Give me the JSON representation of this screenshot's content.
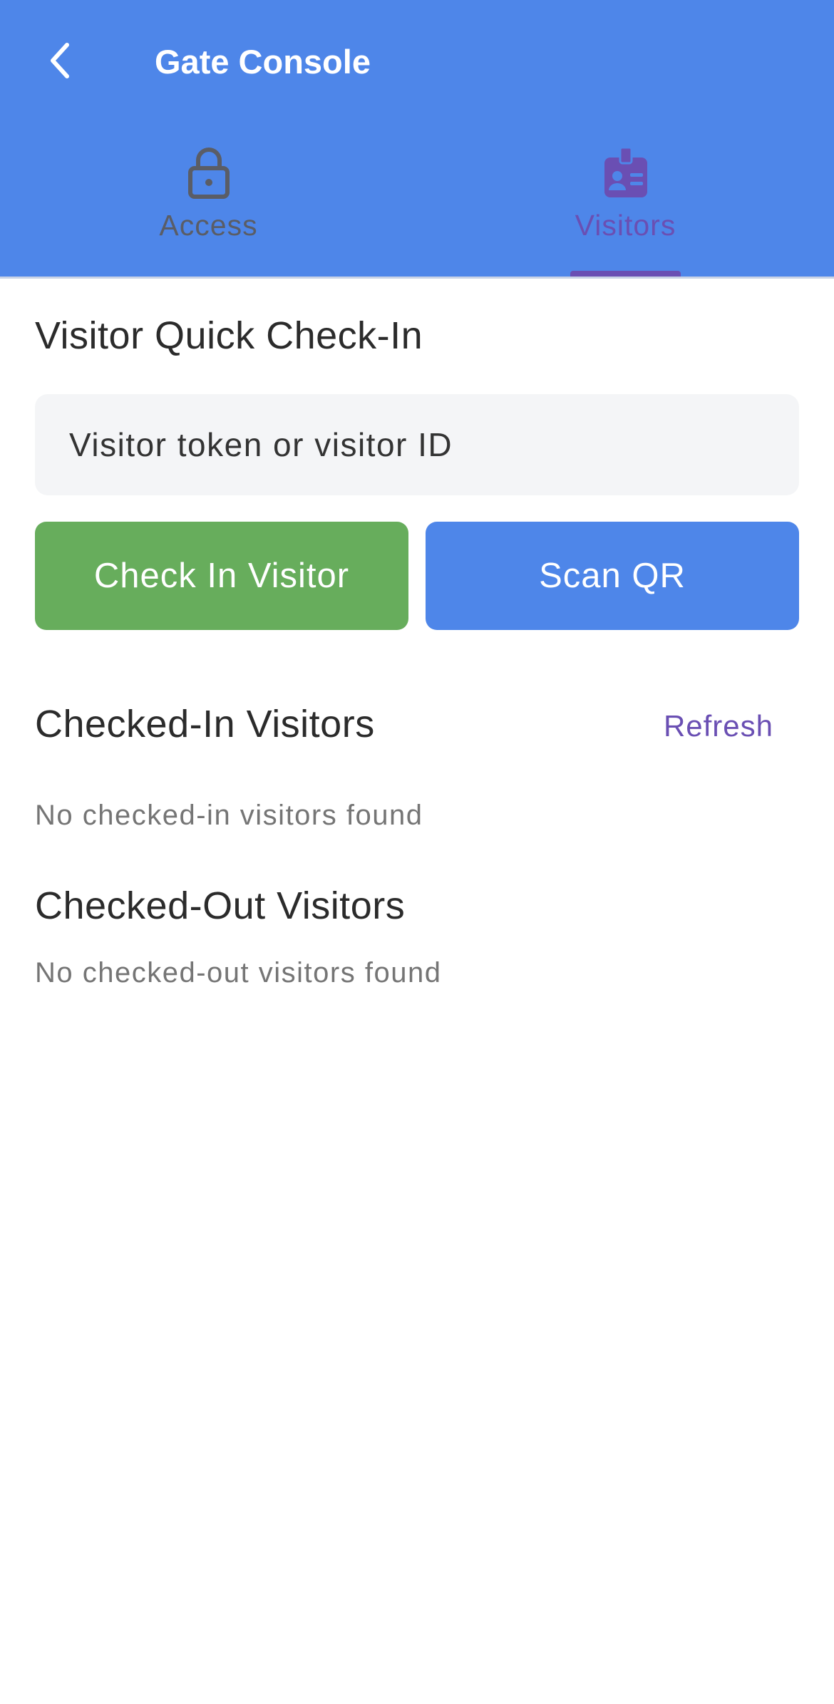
{
  "header": {
    "title": "Gate Console",
    "background": "#4e86e9"
  },
  "tabs": [
    {
      "label": "Access",
      "icon": "lock-icon",
      "active": false
    },
    {
      "label": "Visitors",
      "icon": "id-badge-icon",
      "active": true
    }
  ],
  "checkin": {
    "title": "Visitor Quick Check-In",
    "input_placeholder": "Visitor token or visitor ID",
    "input_value": "",
    "checkin_button": "Check In Visitor",
    "scan_button": "Scan QR"
  },
  "checked_in": {
    "title": "Checked-In Visitors",
    "refresh": "Refresh",
    "empty": "No checked-in visitors found"
  },
  "checked_out": {
    "title": "Checked-Out Visitors",
    "empty": "No checked-out visitors found"
  },
  "colors": {
    "primary": "#4e86e9",
    "accent": "#6a4fb3",
    "success": "#67ad5c"
  }
}
